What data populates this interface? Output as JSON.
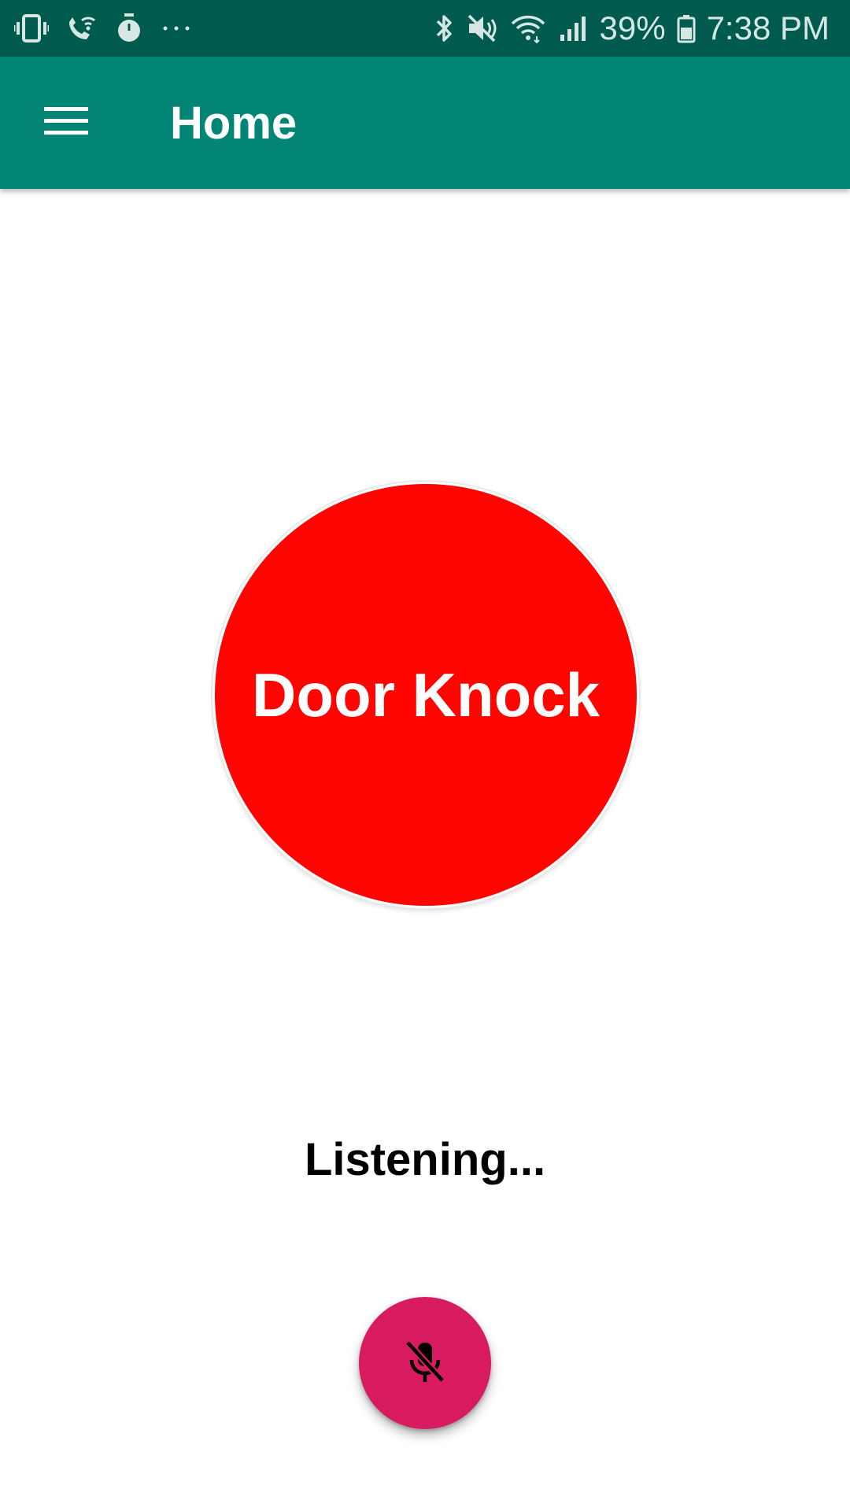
{
  "status_bar": {
    "left_icons": [
      "vibrate-icon",
      "wifi-calling-icon",
      "stopwatch-icon",
      "more-notifications-icon"
    ],
    "right_icons": [
      "bluetooth-icon",
      "mute-icon",
      "wifi-icon",
      "signal-icon",
      "battery-icon"
    ],
    "battery": "39%",
    "time": "7:38 PM"
  },
  "app_bar": {
    "menu_icon": "hamburger-menu-icon",
    "title": "Home",
    "color": "#038576"
  },
  "main": {
    "door_knock_label": "Door Knock",
    "door_knock_color": "#ff0400",
    "status_text": "Listening...",
    "fab_icon": "mic-off-icon",
    "fab_color": "#d81b60"
  }
}
